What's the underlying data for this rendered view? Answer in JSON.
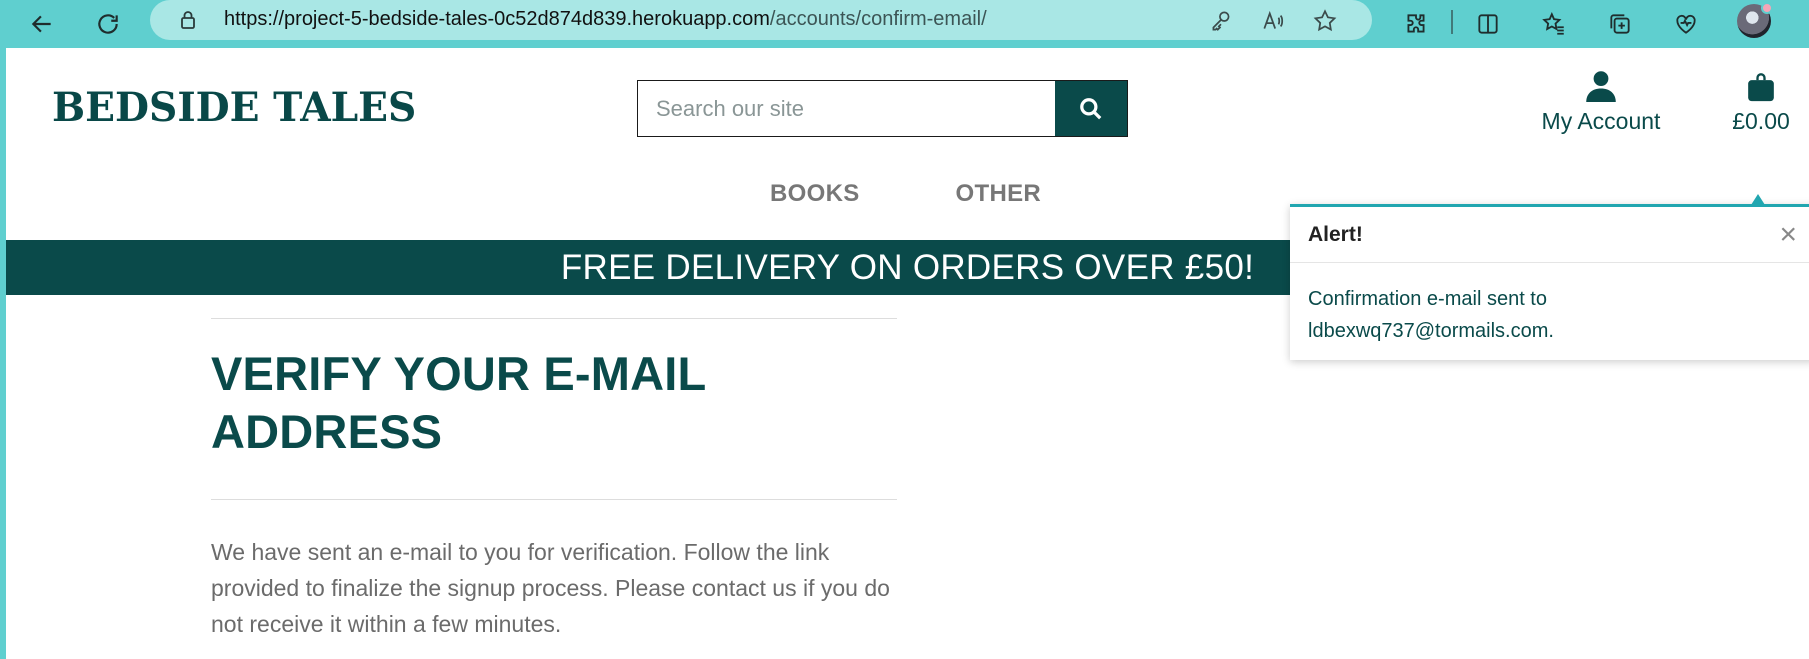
{
  "browser": {
    "url_main": "https://project-5-bedside-tales-0c52d874d839.herokuapp.com",
    "url_path": "/accounts/confirm-email/"
  },
  "header": {
    "logo": "BEDSIDE TALES",
    "search_placeholder": "Search our site",
    "account_label": "My Account",
    "cart_total": "£0.00"
  },
  "nav": {
    "books": "BOOKS",
    "other": "OTHER"
  },
  "banner": "FREE DELIVERY ON ORDERS OVER £50!",
  "main": {
    "title_line1": "VERIFY YOUR E-MAIL",
    "title_line2": "ADDRESS",
    "description": "We have sent an e-mail to you for verification. Follow the link provided to finalize the signup process. Please contact us if you do not receive it within a few minutes."
  },
  "toast": {
    "title": "Alert!",
    "close": "×",
    "message_line1": "Confirmation e-mail sent to",
    "message_line2": "ldbexwq737@tormails.com."
  },
  "colors": {
    "brand": "#0a4a4a",
    "chrome": "#5fcfcf",
    "toast_accent": "#21a6b0"
  }
}
